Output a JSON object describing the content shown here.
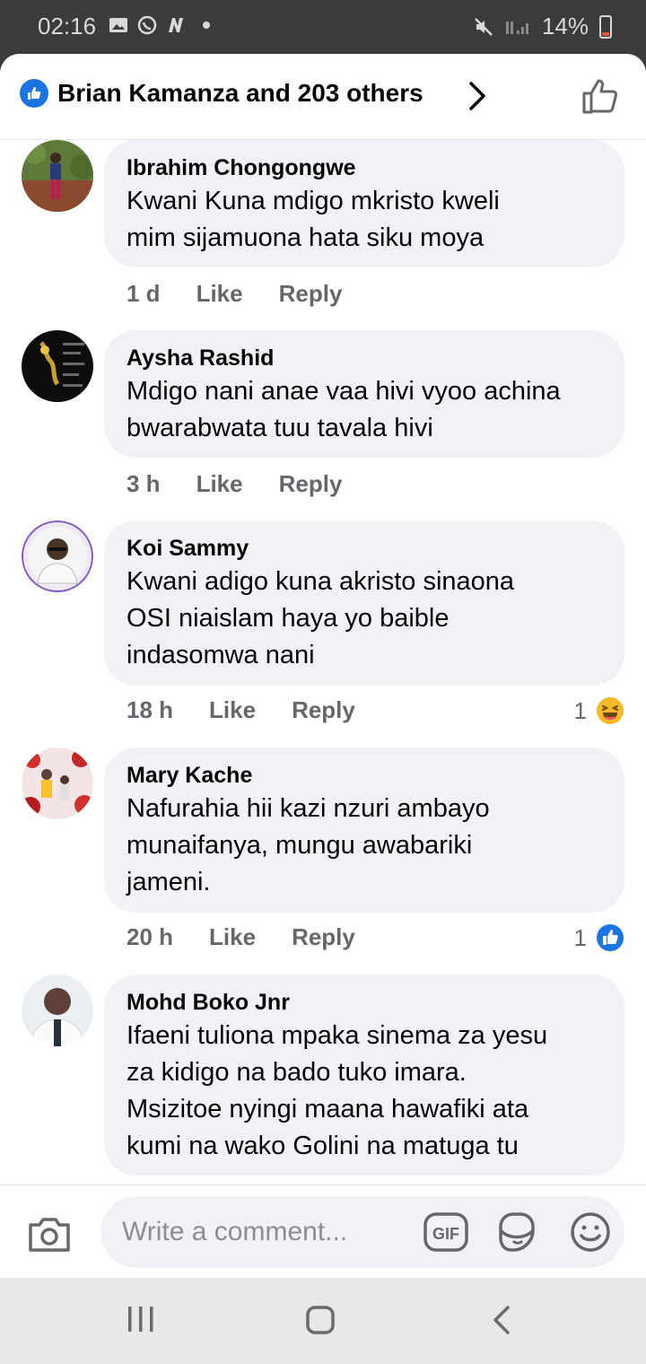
{
  "status_bar": {
    "time": "02:16",
    "battery": "14%",
    "icons": [
      "gallery-icon",
      "whatsapp-icon",
      "n-app-icon",
      "mute-icon",
      "signal-icon",
      "battery-icon"
    ]
  },
  "header": {
    "reactions_text": "Brian Kamanza and 203 others",
    "icons": [
      "like-badge-icon",
      "chevron-right-icon",
      "thumbs-up-icon"
    ]
  },
  "comments": [
    {
      "author": "Ibrahim Chongongwe",
      "lines": [
        "Kwani Kuna mdigo mkristo kweli",
        "mim sijamuona hata siku moya"
      ],
      "time": "1 d",
      "like": "Like",
      "reply": "Reply",
      "reactions": null
    },
    {
      "author": "Aysha Rashid",
      "lines": [
        "Mdigo nani anae vaa hivi vyoo achina",
        "bwarabwata tuu tavala hivi"
      ],
      "time": "3 h",
      "like": "Like",
      "reply": "Reply",
      "reactions": null
    },
    {
      "author": "Koi Sammy",
      "lines": [
        "Kwani adigo kuna akristo sinaona",
        "OSI niaislam haya yo baible",
        "indasomwa nani"
      ],
      "time": "18 h",
      "like": "Like",
      "reply": "Reply",
      "reactions": {
        "count": "1",
        "icon": "haha-emoji-icon"
      }
    },
    {
      "author": "Mary Kache",
      "lines": [
        "Nafurahia hii kazi nzuri ambayo",
        "munaifanya, mungu awabariki",
        "jameni."
      ],
      "time": "20 h",
      "like": "Like",
      "reply": "Reply",
      "reactions": {
        "count": "1",
        "icon": "like-reaction-icon"
      }
    },
    {
      "author": "Mohd Boko Jnr",
      "lines": [
        "Ifaeni tuliona mpaka sinema za yesu",
        "za kidigo na bado tuko imara.",
        "Msizitoe nyingi maana hawafiki ata",
        "kumi na wako Golini na matuga tu"
      ],
      "time": "",
      "like": "",
      "reply": "",
      "reactions": null
    }
  ],
  "composer": {
    "placeholder": "Write a comment...",
    "gif_label": "GIF",
    "icons": [
      "camera-icon",
      "gif-icon",
      "sticker-icon",
      "emoji-icon"
    ]
  },
  "navbar": {
    "icons": [
      "recent-apps-icon",
      "home-icon",
      "back-icon"
    ]
  },
  "colors": {
    "accent": "#1b74e4",
    "bubble": "#f0f2f5",
    "secondary_text": "#65676b",
    "status_bar": "#3b3b3b"
  }
}
